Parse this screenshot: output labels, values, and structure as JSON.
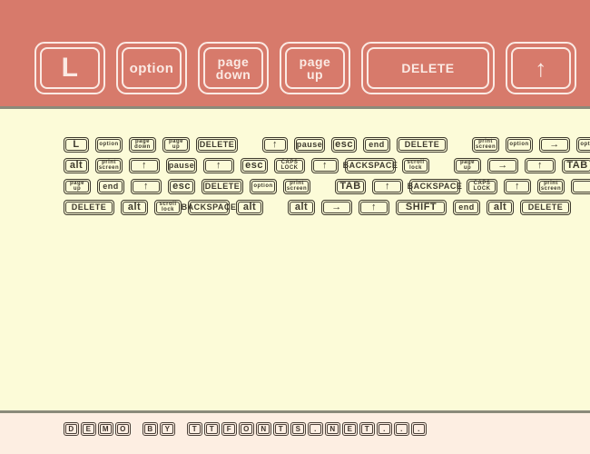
{
  "colors": {
    "banner_bg": "#D77A6B",
    "banner_ink": "#FBEAE4",
    "specimen_bg": "#FCFBD8",
    "specimen_ink": "#3E3A2E",
    "footer_bg": "#FDEEE2",
    "footer_ink": "#3B332C",
    "rule": "#8A8A7A"
  },
  "banner": {
    "keys": [
      {
        "label": "L",
        "size": "xl",
        "width": "k-letter"
      },
      {
        "label": "option",
        "size": "lg",
        "width": "k-word"
      },
      {
        "label": "page\ndown",
        "size": "stack",
        "width": "k-two"
      },
      {
        "label": "page\nup",
        "size": "stack",
        "width": "k-two"
      },
      {
        "label": "DELETE",
        "size": "md",
        "width": "k-wide"
      },
      {
        "label": "↑",
        "size": "arrow",
        "width": "k-arrow"
      }
    ]
  },
  "specimen": {
    "rows": [
      {
        "keys": [
          {
            "label": "L",
            "style": "big",
            "width": "w1"
          },
          {
            "label": "option",
            "style": "tiny",
            "width": "w2"
          },
          {
            "label": "page\ndown",
            "style": "tiny",
            "width": "w2"
          },
          {
            "label": "page\nup",
            "style": "tiny",
            "width": "w2"
          },
          {
            "label": "DELETE",
            "style": "norm",
            "width": "w4"
          },
          {
            "label": "",
            "style": "gap",
            "width": ""
          },
          {
            "label": "↑",
            "style": "arr",
            "width": "w1"
          },
          {
            "label": "pause",
            "style": "norm",
            "width": "w3"
          },
          {
            "label": "esc",
            "style": "big",
            "width": "w1"
          },
          {
            "label": "end",
            "style": "norm",
            "width": "w2"
          },
          {
            "label": "DELETE",
            "style": "norm",
            "width": "w5"
          },
          {
            "label": "",
            "style": "gap",
            "width": ""
          },
          {
            "label": "print\nscreen",
            "style": "tiny",
            "width": "w2"
          },
          {
            "label": "option",
            "style": "tiny",
            "width": "w2"
          },
          {
            "label": "→",
            "style": "arr",
            "width": "w3"
          },
          {
            "label": "option",
            "style": "tiny",
            "width": "w2"
          }
        ]
      },
      {
        "keys": [
          {
            "label": "alt",
            "style": "big",
            "width": "w1"
          },
          {
            "label": "print\nscreen",
            "style": "tiny",
            "width": "w2"
          },
          {
            "label": "↑",
            "style": "arr",
            "width": "w3"
          },
          {
            "label": "pause",
            "style": "norm",
            "width": "w3"
          },
          {
            "label": "↑",
            "style": "arr",
            "width": "w3"
          },
          {
            "label": "esc",
            "style": "big",
            "width": "w2"
          },
          {
            "label": "CAPS\nLOCK",
            "style": "tiny",
            "width": "w3"
          },
          {
            "label": "↑",
            "style": "arr",
            "width": "w2"
          },
          {
            "label": "BACKSPACE",
            "style": "norm",
            "width": "w5"
          },
          {
            "label": "scroll\nlock",
            "style": "tiny",
            "width": "w2"
          },
          {
            "label": "",
            "style": "gap",
            "width": ""
          },
          {
            "label": "page\nup",
            "style": "tiny",
            "width": "w2"
          },
          {
            "label": "→",
            "style": "arr",
            "width": "w3"
          },
          {
            "label": "↑",
            "style": "arr",
            "width": "w3"
          },
          {
            "label": "TAB",
            "style": "big",
            "width": "w3"
          },
          {
            "label": "",
            "style": "norm",
            "width": "w1"
          }
        ]
      },
      {
        "keys": [
          {
            "label": "page\nup",
            "style": "tiny",
            "width": "w2"
          },
          {
            "label": "end",
            "style": "norm",
            "width": "w2"
          },
          {
            "label": "↑",
            "style": "arr",
            "width": "w3"
          },
          {
            "label": "esc",
            "style": "big",
            "width": "w2"
          },
          {
            "label": "DELETE",
            "style": "norm",
            "width": "w4"
          },
          {
            "label": "option",
            "style": "tiny",
            "width": "w2"
          },
          {
            "label": "print\nscreen",
            "style": "tiny",
            "width": "w2"
          },
          {
            "label": "",
            "style": "gap",
            "width": ""
          },
          {
            "label": "TAB",
            "style": "big",
            "width": "w3"
          },
          {
            "label": "↑",
            "style": "arr",
            "width": "w3"
          },
          {
            "label": "BACKSPACE",
            "style": "norm",
            "width": "w5"
          },
          {
            "label": "CAPS\nLOCK",
            "style": "tiny",
            "width": "w3"
          },
          {
            "label": "↑",
            "style": "arr",
            "width": "w2"
          },
          {
            "label": "print\nscreen",
            "style": "tiny",
            "width": "w2"
          },
          {
            "label": "",
            "style": "norm",
            "width": "w1"
          }
        ]
      },
      {
        "keys": [
          {
            "label": "DELETE",
            "style": "norm",
            "width": "w5"
          },
          {
            "label": "alt",
            "style": "big",
            "width": "w2"
          },
          {
            "label": "scroll\nlock",
            "style": "tiny",
            "width": "w2"
          },
          {
            "label": "BACKSPACE",
            "style": "norm",
            "width": "w4"
          },
          {
            "label": "alt",
            "style": "big",
            "width": "w2"
          },
          {
            "label": "",
            "style": "gap",
            "width": ""
          },
          {
            "label": "alt",
            "style": "big",
            "width": "w2"
          },
          {
            "label": "→",
            "style": "arr",
            "width": "w3"
          },
          {
            "label": "↑",
            "style": "arr",
            "width": "w3"
          },
          {
            "label": "SHIFT",
            "style": "big",
            "width": "w5"
          },
          {
            "label": "end",
            "style": "norm",
            "width": "w2"
          },
          {
            "label": "alt",
            "style": "big",
            "width": "w2"
          },
          {
            "label": "DELETE",
            "style": "norm",
            "width": "w5"
          }
        ]
      }
    ]
  },
  "footer": {
    "text": "DEMO BY TTFONTS.NET...",
    "characters": [
      "D",
      "E",
      "M",
      "O",
      " ",
      "B",
      "Y",
      " ",
      "T",
      "T",
      "F",
      "O",
      "N",
      "T",
      "S",
      ".",
      "N",
      "E",
      "T",
      ".",
      ".",
      "."
    ]
  }
}
